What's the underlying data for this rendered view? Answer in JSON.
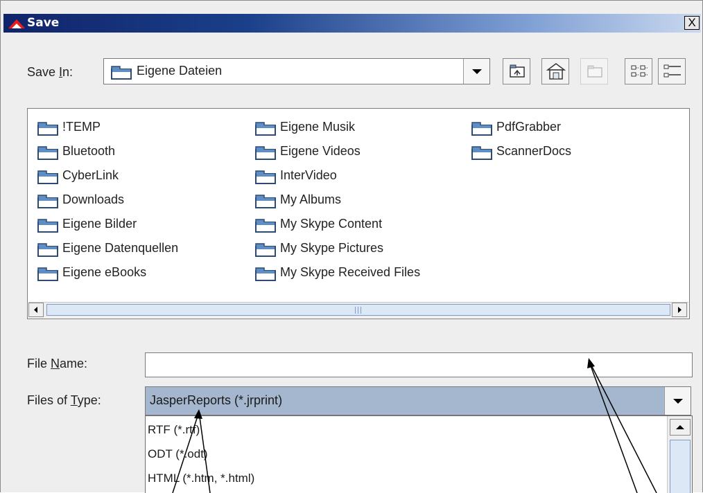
{
  "window": {
    "title": "Save",
    "close_label": "X"
  },
  "save_in": {
    "label_prefix": "Save ",
    "label_mnemonic": "I",
    "label_suffix": "n:",
    "current_folder": "Eigene Dateien"
  },
  "toolbar": {
    "buttons": [
      "up-one-level",
      "home",
      "new-folder",
      "list-view",
      "details-view"
    ],
    "new_folder_enabled": false
  },
  "file_list": {
    "columns": [
      [
        "!TEMP",
        "Bluetooth",
        "CyberLink",
        "Downloads",
        "Eigene Bilder",
        "Eigene Datenquellen",
        "Eigene eBooks"
      ],
      [
        "Eigene Musik",
        "Eigene Videos",
        "InterVideo",
        "My Albums",
        "My Skype Content",
        "My Skype Pictures",
        "My Skype Received Files"
      ],
      [
        "PdfGrabber",
        "ScannerDocs"
      ]
    ],
    "scroll_thumb_grip": "|||"
  },
  "file_name": {
    "label_prefix": "File ",
    "label_mnemonic": "N",
    "label_suffix": "ame:",
    "value": ""
  },
  "files_of_type": {
    "label_prefix": "Files of ",
    "label_mnemonic": "T",
    "label_suffix": "ype:",
    "selected": "JasperReports (*.jrprint)",
    "options": [
      "RTF (*.rtf)",
      "ODT (*.odt)",
      "HTML (*.htm, *.html)"
    ]
  },
  "colors": {
    "title_gradient_start": "#10246a",
    "title_gradient_end": "#c9d8ee",
    "selection": "#a4b7ce",
    "dialog_bg": "#eeeeee"
  }
}
